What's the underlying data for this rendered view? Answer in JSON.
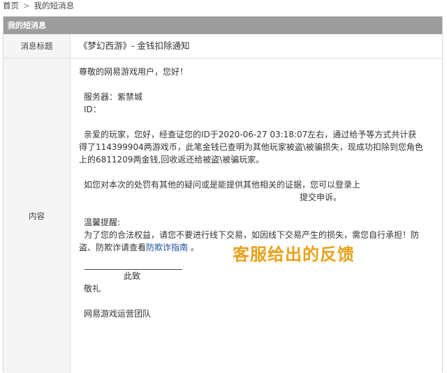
{
  "breadcrumb": {
    "home": "首页",
    "separator": ">",
    "current": "我的短消息"
  },
  "panel": {
    "title": "我的短消息"
  },
  "message": {
    "title_label": "消息标题",
    "title_value": "《梦幻西游》- 金钱扣除通知",
    "content_label": "内容",
    "greeting": "尊敬的网易游戏用户，您好！",
    "server_line": "服务器：紫禁城",
    "id_line": "ID：",
    "para1_line1": "亲爱的玩家，您好，经查证您的ID于2020-06-27 03:18:07左右，通过给予等方式共计获",
    "para1_line2": "得了114399904两游戏币，此笔金钱已查明为其他玩家被盗\\被骗损失，现成功扣除到您角色",
    "para1_line3": "上的6811209两金钱,回收返还给被盗\\被骗玩家。",
    "para2_line1": "如您对本次的处罚有其他的疑问或是能提供其他相关的证据，您可以登录上",
    "para2_line2": "提交申诉。",
    "tips_title": "温馨提醒:",
    "tips_line1": "为了您的合法权益，请您不要进行线下交易，如因线下交易产生的损失，需您自行承担！防",
    "tips_line2_pre": "盗、防欺诈请查看",
    "tips_link": "防欺诈指南",
    "tips_line2_post": "。",
    "closing1": "此致",
    "closing2": "敬礼",
    "signature": "网易游戏运营团队"
  },
  "overlay_caption": "客服给出的反馈",
  "colors": {
    "header_bg": "#9d9d9d",
    "overlay": "#e8a21a",
    "link": "#1a4fa0"
  }
}
